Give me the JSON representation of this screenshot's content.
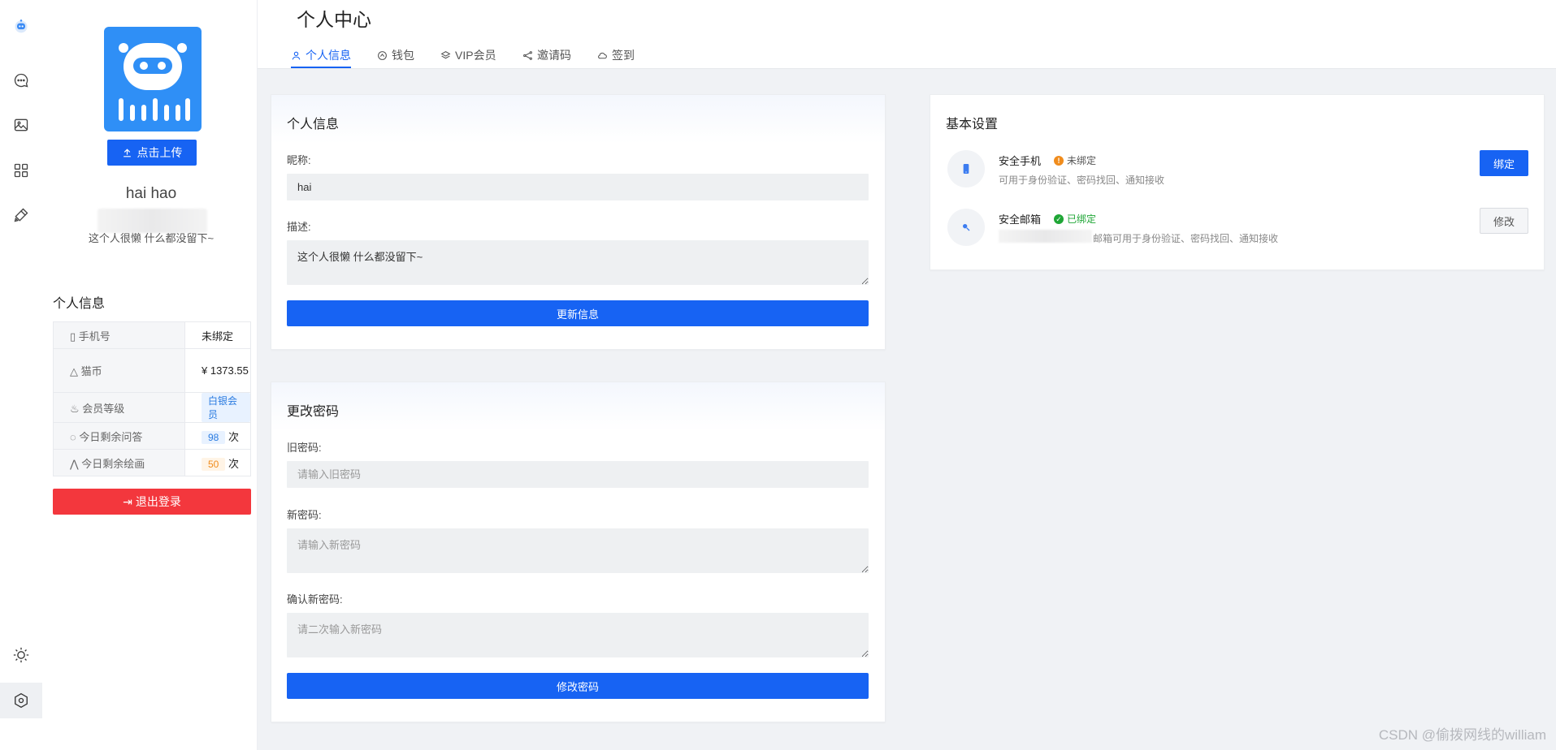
{
  "header": {
    "title": "个人中心",
    "tabs": [
      {
        "label": "个人信息",
        "icon": "user-icon"
      },
      {
        "label": "钱包",
        "icon": "wallet-icon"
      },
      {
        "label": "VIP会员",
        "icon": "layers-icon"
      },
      {
        "label": "邀请码",
        "icon": "share-icon"
      },
      {
        "label": "签到",
        "icon": "cloud-icon"
      }
    ]
  },
  "rail": {
    "items": [
      "robot-logo-icon",
      "chat-icon",
      "image-icon",
      "apps-icon",
      "paint-icon"
    ],
    "bottom": [
      "sun-icon",
      "settings-icon"
    ]
  },
  "profile": {
    "upload_label": "点击上传",
    "username": "hai hao",
    "bio": "这个人很懒 什么都没留下~",
    "info_title": "个人信息",
    "rows": [
      {
        "key": "手机号",
        "value": "未绑定"
      },
      {
        "key": "猫币",
        "value": "¥ 1373.55"
      },
      {
        "key": "会员等级",
        "value": "白银会员"
      },
      {
        "key": "今日剩余问答",
        "count": "98",
        "unit": "次"
      },
      {
        "key": "今日剩余绘画",
        "count": "50",
        "unit": "次"
      }
    ],
    "logout_label": "退出登录"
  },
  "info_card": {
    "title": "个人信息",
    "nickname_label": "昵称:",
    "nickname_value": "hai",
    "desc_label": "描述:",
    "desc_value": "这个人很懒 什么都没留下~",
    "submit_label": "更新信息"
  },
  "password_card": {
    "title": "更改密码",
    "old_label": "旧密码:",
    "old_placeholder": "请输入旧密码",
    "new_label": "新密码:",
    "new_placeholder": "请输入新密码",
    "confirm_label": "确认新密码:",
    "confirm_placeholder": "请二次输入新密码",
    "submit_label": "修改密码"
  },
  "settings_card": {
    "title": "基本设置",
    "items": [
      {
        "title": "安全手机",
        "status": "未绑定",
        "desc": "可用于身份验证、密码找回、通知接收",
        "action": "绑定"
      },
      {
        "title": "安全邮箱",
        "status": "已绑定",
        "desc": "邮箱可用于身份验证、密码找回、通知接收",
        "action": "修改"
      }
    ]
  },
  "colors": {
    "primary": "#1763f3",
    "danger": "#f3373d",
    "warning": "#f08c1c",
    "success": "#1fa636"
  },
  "watermark": "CSDN @偷拨网线的william"
}
